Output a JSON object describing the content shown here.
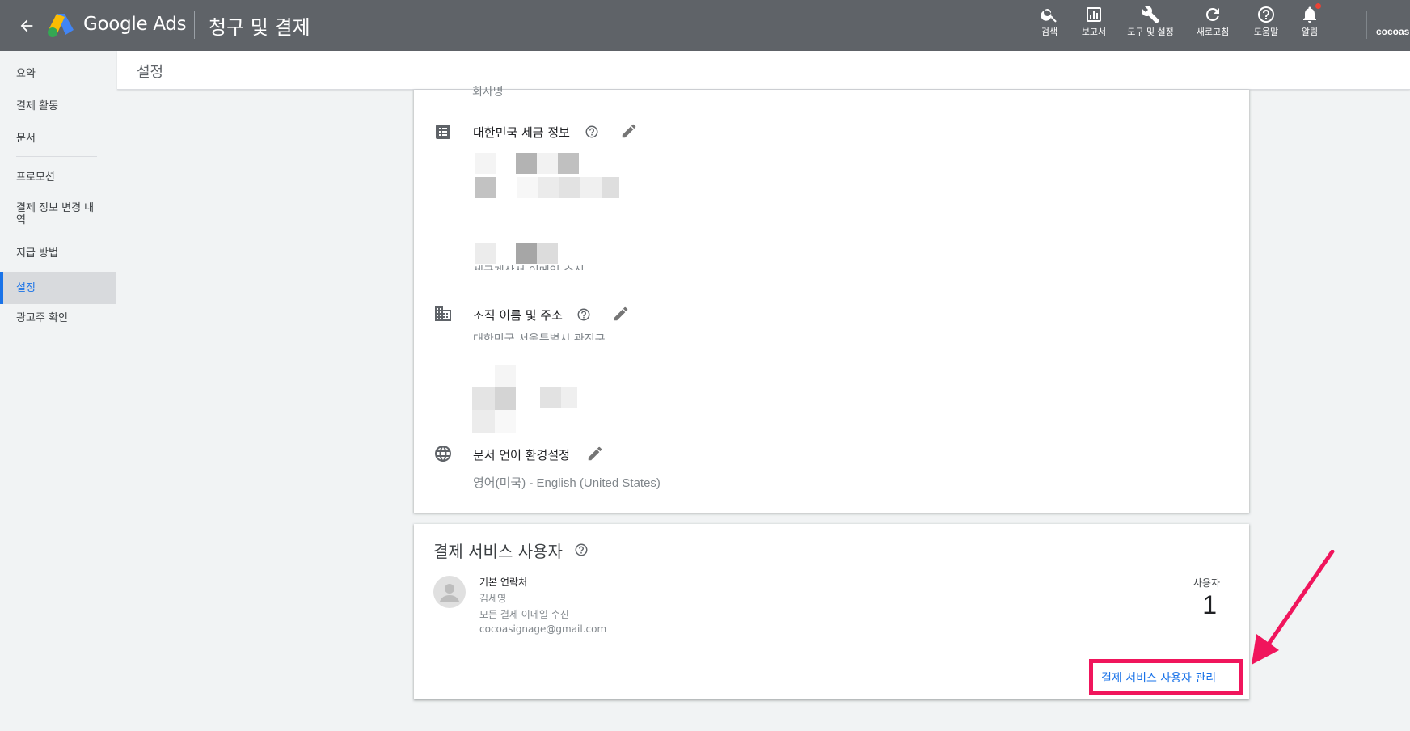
{
  "topbar": {
    "brand": "Google Ads",
    "page_title": "청구 및 결제",
    "actions": [
      {
        "label": "검색",
        "icon": "search-icon"
      },
      {
        "label": "보고서",
        "icon": "reports-icon"
      },
      {
        "label": "도구 및 설정",
        "icon": "wrench-icon"
      },
      {
        "label": "새로고침",
        "icon": "refresh-icon"
      },
      {
        "label": "도움말",
        "icon": "help-icon"
      },
      {
        "label": "알림",
        "icon": "bell-icon"
      }
    ],
    "account": "cocoas"
  },
  "sidebar": {
    "items": [
      {
        "label": "요약"
      },
      {
        "label": "결제 활동"
      },
      {
        "label": "문서"
      },
      {
        "label": "프로모션"
      },
      {
        "label": "결제 정보 변경 내역"
      },
      {
        "label": "지급 방법"
      },
      {
        "label": "설정",
        "active": true
      },
      {
        "label": "광고주 확인"
      }
    ]
  },
  "header": {
    "title": "설정"
  },
  "settings": {
    "top_cut_text": "회사명",
    "tax": {
      "title": "대한민국 세금 정보",
      "bottom_cut_text": "세금계산서 이메일 수신"
    },
    "org": {
      "title": "조직 이름 및 주소",
      "cut_text": "대한민국 서울특별시 관진구"
    },
    "lang": {
      "title": "문서 언어 환경설정",
      "value": "영어(미국) - English (United States)"
    }
  },
  "payment_users": {
    "title": "결제 서비스 사용자",
    "contact_type": "기본 연락처",
    "name": "김세영",
    "email_pref": "모든 결제 이메일 수신",
    "email": "cocoasignage@gmail.com",
    "count_label": "사용자",
    "count": "1",
    "manage_label": "결제 서비스 사용자 관리"
  },
  "colors": {
    "topbar": "#5f6368",
    "accent": "#1a73e8",
    "highlight": "#f0155c"
  }
}
